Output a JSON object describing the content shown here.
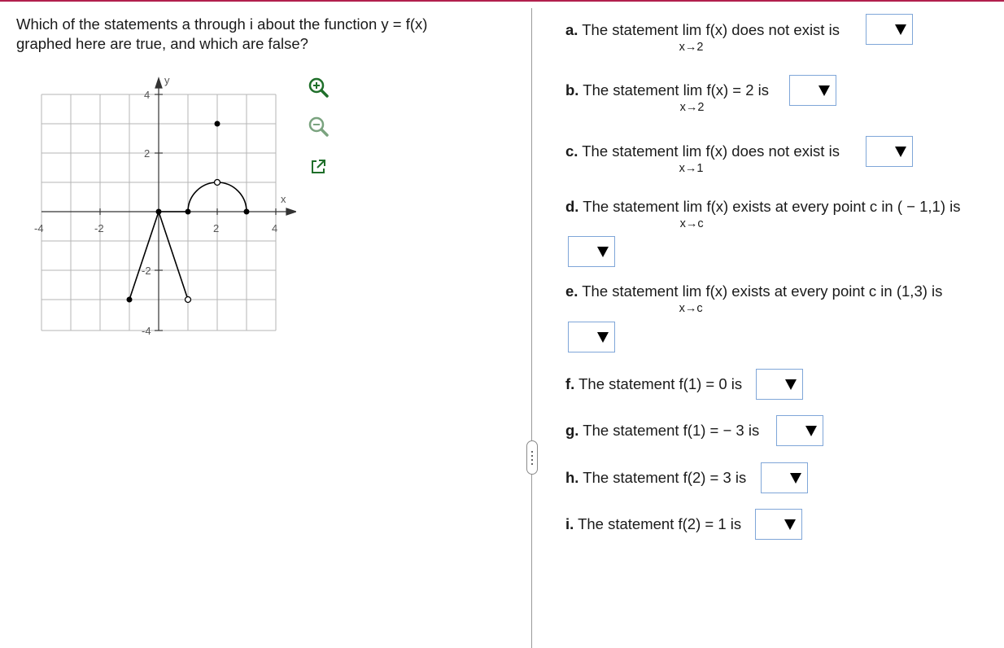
{
  "question": {
    "line1": "Which of the statements a through i about the function y = f(x)",
    "line2": "graphed here are true, and which are false?"
  },
  "graph": {
    "axis_x_label": "x",
    "axis_y_label": "y",
    "x_ticks": [
      "-4",
      "-2",
      "2",
      "4"
    ],
    "y_ticks": [
      "4",
      "2",
      "-2",
      "-4"
    ]
  },
  "tools": {
    "zoom_in": "zoom-in-icon",
    "zoom_out": "zoom-out-icon",
    "popout": "popout-icon"
  },
  "statements": [
    {
      "letter": "a.",
      "pre": "The statement",
      "lim": "lim",
      "sub": "x→2",
      "post": "f(x) does not exist is"
    },
    {
      "letter": "b.",
      "pre": "The statement",
      "lim": "lim",
      "sub": "x→2",
      "post": "f(x) = 2 is"
    },
    {
      "letter": "c.",
      "pre": "The statement",
      "lim": "lim",
      "sub": "x→1",
      "post": "f(x) does not exist is"
    },
    {
      "letter": "d.",
      "pre": "The statement",
      "lim": "lim",
      "sub": "x→c",
      "post": "f(x) exists at every point c in ( − 1,1) is"
    },
    {
      "letter": "e.",
      "pre": "The statement",
      "lim": "lim",
      "sub": "x→c",
      "post": "f(x) exists at every point c in (1,3) is"
    },
    {
      "letter": "f.",
      "text": "The statement f(1) = 0 is"
    },
    {
      "letter": "g.",
      "text": "The statement f(1) = − 3 is"
    },
    {
      "letter": "h.",
      "text": "The statement f(2) = 3 is"
    },
    {
      "letter": "i.",
      "text": "The statement f(2) = 1 is"
    }
  ],
  "dropdowns": {
    "selected": ""
  },
  "colors": {
    "accent_rule": "#b2204d",
    "dropdown_border": "#7fa6d8",
    "grid": "#b5b5b5"
  }
}
